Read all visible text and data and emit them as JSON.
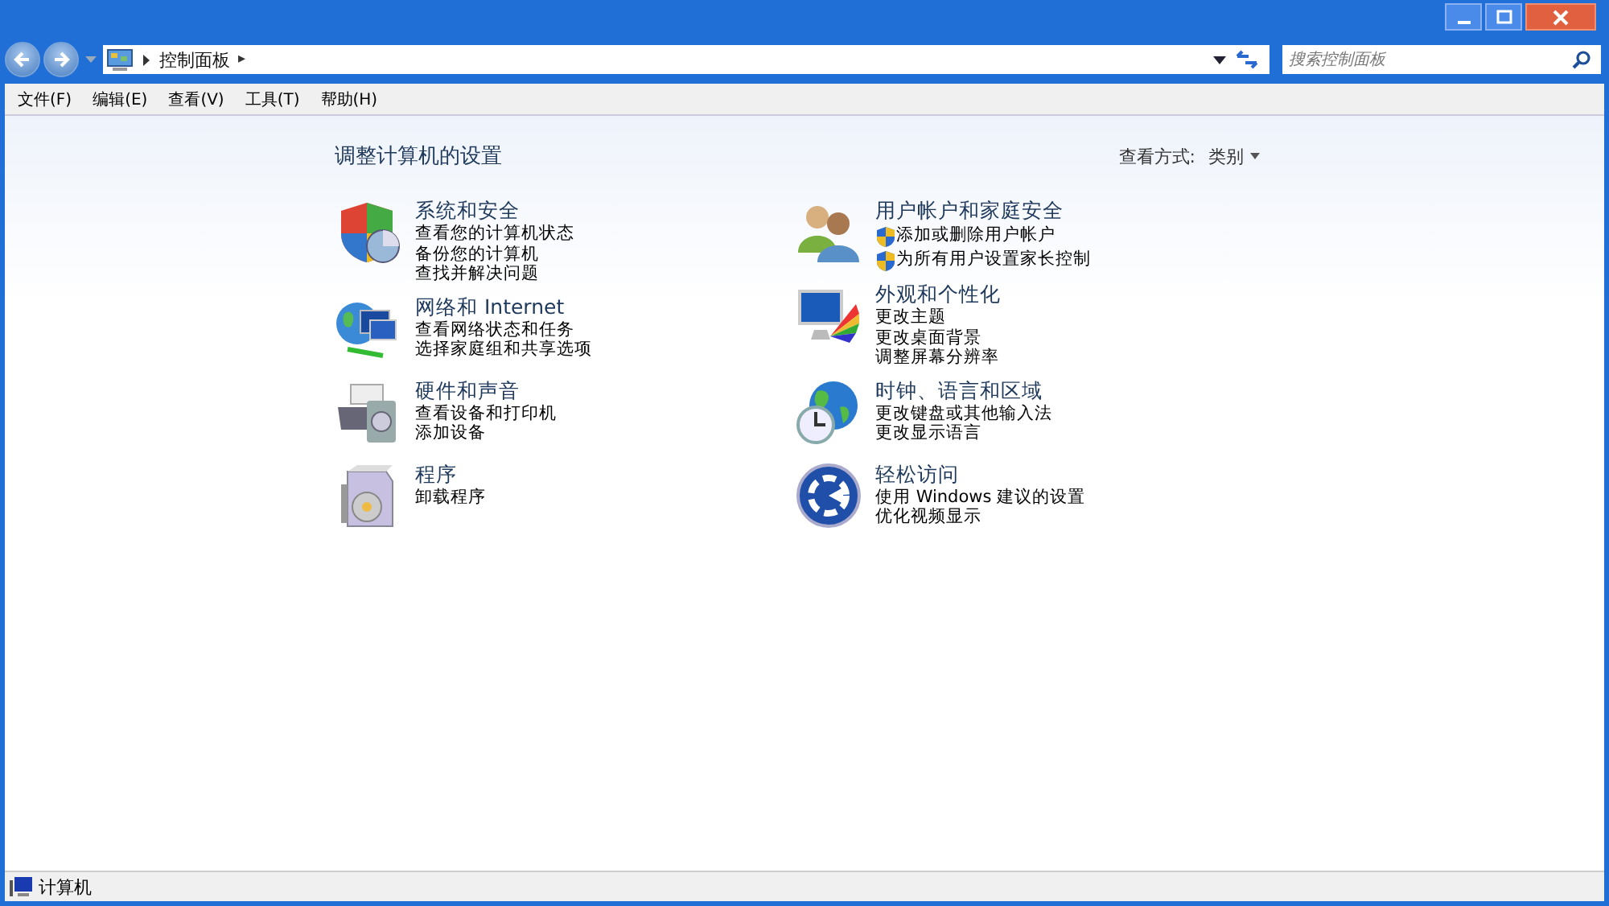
{
  "address_bar": {
    "path": "控制面板",
    "separator_after": "▸"
  },
  "search": {
    "placeholder": "搜索控制面板"
  },
  "menu": [
    "文件(F)",
    "编辑(E)",
    "查看(V)",
    "工具(T)",
    "帮助(H)"
  ],
  "heading": "调整计算机的设置",
  "view_by": {
    "label": "查看方式:",
    "value": "类别"
  },
  "columns": [
    [
      {
        "title": "系统和安全",
        "links": [
          {
            "text": "查看您的计算机状态",
            "kind": "plain"
          },
          {
            "text": "备份您的计算机",
            "kind": "plain"
          },
          {
            "text": "查找并解决问题",
            "kind": "plain"
          }
        ]
      },
      {
        "title": "网络和 Internet",
        "links": [
          {
            "text": "查看网络状态和任务",
            "kind": "plain"
          },
          {
            "text": "选择家庭组和共享选项",
            "kind": "plain"
          }
        ]
      },
      {
        "title": "硬件和声音",
        "links": [
          {
            "text": "查看设备和打印机",
            "kind": "plain"
          },
          {
            "text": "添加设备",
            "kind": "plain"
          }
        ]
      },
      {
        "title": "程序",
        "links": [
          {
            "text": "卸载程序",
            "kind": "plain"
          }
        ]
      }
    ],
    [
      {
        "title": "用户帐户和家庭安全",
        "links": [
          {
            "text": "添加或删除用户帐户",
            "kind": "shield"
          },
          {
            "text": "为所有用户设置家长控制",
            "kind": "shield"
          }
        ]
      },
      {
        "title": "外观和个性化",
        "links": [
          {
            "text": "更改主题",
            "kind": "plain"
          },
          {
            "text": "更改桌面背景",
            "kind": "plain"
          },
          {
            "text": "调整屏幕分辨率",
            "kind": "plain"
          }
        ]
      },
      {
        "title": "时钟、语言和区域",
        "links": [
          {
            "text": "更改键盘或其他输入法",
            "kind": "plain"
          },
          {
            "text": "更改显示语言",
            "kind": "plain"
          }
        ]
      },
      {
        "title": "轻松访问",
        "links": [
          {
            "text": "使用 Windows 建议的设置",
            "kind": "plain"
          },
          {
            "text": "优化视频显示",
            "kind": "plain"
          }
        ]
      }
    ]
  ],
  "status_bar": {
    "text": "计算机"
  }
}
